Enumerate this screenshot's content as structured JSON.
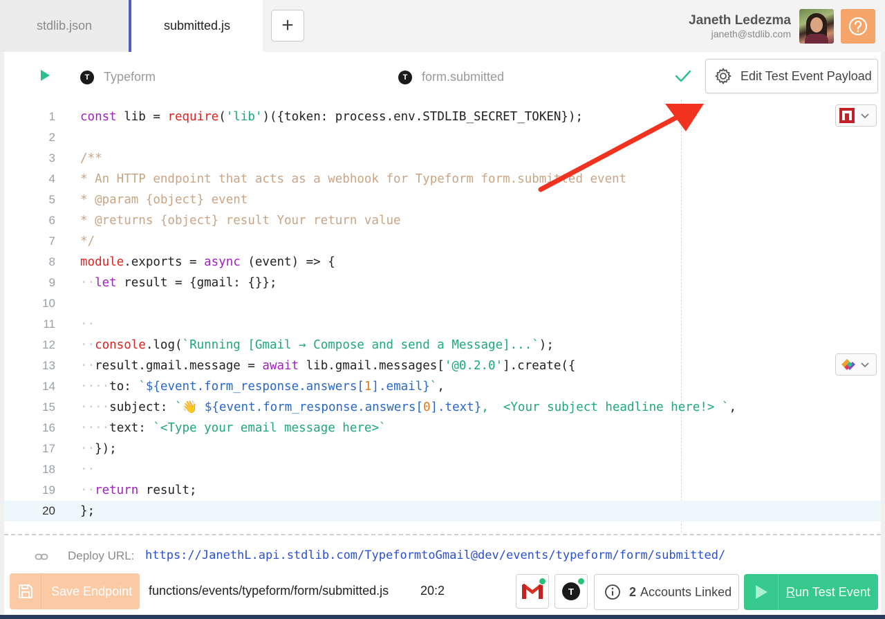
{
  "tabs": [
    {
      "label": "stdlib.json",
      "active": false
    },
    {
      "label": "submitted.js",
      "active": true
    }
  ],
  "add_tab_label": "+",
  "user": {
    "name": "Janeth Ledezma",
    "email": "janeth@stdlib.com"
  },
  "editor_header": {
    "service": "Typeform",
    "event": "form.submitted",
    "service_icon_letter": "T",
    "edit_payload_label": "Edit Test Event Payload"
  },
  "code_lines": [
    {
      "n": "1",
      "html": "<span class=\"kw\">const</span> lib = <span class=\"fn\">require</span>(<span class=\"str\">'lib'</span>)({token: process.env.STDLIB_SECRET_TOKEN});"
    },
    {
      "n": "2",
      "html": ""
    },
    {
      "n": "3",
      "html": "<span class=\"cm\">/**</span>"
    },
    {
      "n": "4",
      "html": "<span class=\"cm\">* An HTTP endpoint that acts as a webhook for Typeform form.submitted event</span>"
    },
    {
      "n": "5",
      "html": "<span class=\"cm\">* @param {object} event</span>"
    },
    {
      "n": "6",
      "html": "<span class=\"cm\">* @returns {object} result Your return value</span>"
    },
    {
      "n": "7",
      "html": "<span class=\"cm\">*/</span>"
    },
    {
      "n": "8",
      "html": "<span class=\"fn\">module</span>.exports = <span class=\"kw\">async</span> (event) => {"
    },
    {
      "n": "9",
      "html": "<span class=\"ws\">··</span><span class=\"kw\">let</span> result = {gmail: {}};"
    },
    {
      "n": "10",
      "html": ""
    },
    {
      "n": "11",
      "html": "<span class=\"ws\">··</span>"
    },
    {
      "n": "12",
      "html": "<span class=\"ws\">··</span><span class=\"fn\">console</span>.log(<span class=\"str\">`Running [Gmail → Compose and send a Message]...`</span>);"
    },
    {
      "n": "13",
      "html": "<span class=\"ws\">··</span>result.gmail.message = <span class=\"kw\">await</span> lib.gmail.messages[<span class=\"str\">'@0.2.0'</span>].create({"
    },
    {
      "n": "14",
      "html": "<span class=\"ws\">····</span>to: <span class=\"str\">`</span><span class=\"tpl\">${event.form_response.answers[<span class=\"num\">1</span>].email}</span><span class=\"str\">`</span>,"
    },
    {
      "n": "15",
      "html": "<span class=\"ws\">····</span>subject: <span class=\"str\">`👋 </span><span class=\"tpl\">${event.form_response.answers[<span class=\"num\">0</span>].text}</span><span class=\"str\">,  &lt;Your subject headline here!&gt; `</span>,"
    },
    {
      "n": "16",
      "html": "<span class=\"ws\">····</span>text: <span class=\"str\">`&lt;Type your email message here&gt;`</span>"
    },
    {
      "n": "17",
      "html": "<span class=\"ws\">··</span>});"
    },
    {
      "n": "18",
      "html": "<span class=\"ws\">··</span>"
    },
    {
      "n": "19",
      "html": "<span class=\"ws\">··</span><span class=\"kw\">return</span> result;"
    },
    {
      "n": "20",
      "html": "};"
    }
  ],
  "active_line": "20",
  "deploy": {
    "label": "Deploy URL:",
    "url": "https://JanethL.api.stdlib.com/TypeformtoGmail@dev/events/typeform/form/submitted/"
  },
  "bottom": {
    "save_label": "Save Endpoint",
    "file_path": "functions/events/typeform/form/submitted.js",
    "cursor_pos": "20:2",
    "accounts_count": "2",
    "accounts_label": "Accounts Linked",
    "run_label_underlined": "R",
    "run_label_rest": "un Test Event"
  },
  "colors": {
    "accent_blue": "#4a5fc8",
    "run_green": "#35c98b",
    "save_orange": "#fbc9a3",
    "help_orange": "#f5a46a",
    "annotation_arrow": "#f0321e"
  },
  "icons": [
    "play-icon",
    "check-icon",
    "gear-icon",
    "help-icon",
    "link-icon",
    "save-icon",
    "gmail-icon",
    "typeform-icon",
    "info-icon",
    "chevron-down-icon"
  ]
}
